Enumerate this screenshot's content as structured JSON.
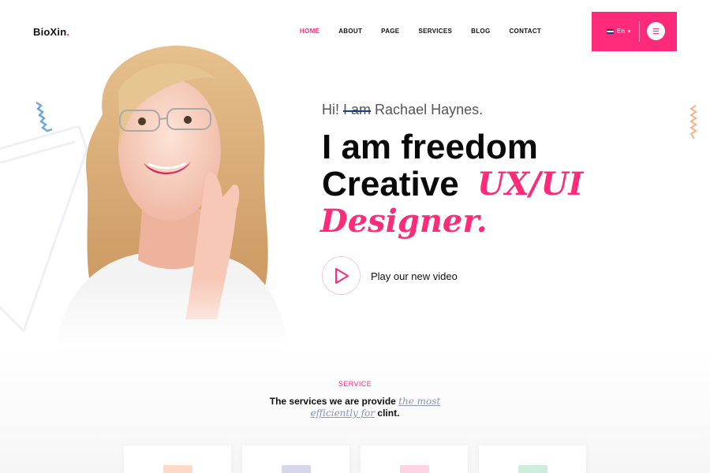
{
  "brand": {
    "name": "BioXin",
    "dot": ".",
    "accent": "#ff2a7a"
  },
  "nav": {
    "items": [
      "HOME",
      "ABOUT",
      "PAGE",
      "SERVICES",
      "BLOG",
      "CONTACT"
    ],
    "active_index": 0
  },
  "language": {
    "label": "En",
    "icon": "uk-flag-icon",
    "dropdown_icon": "chevron-down-icon"
  },
  "menu": {
    "icon": "hamburger-icon"
  },
  "hero": {
    "greeting_prefix": "Hi!",
    "greeting_struck": "I am",
    "greeting_name": "Rachael Haynes.",
    "line1": "I am freedom",
    "line2": "Creative",
    "line2_highlight": "UX/UI",
    "line3_highlight": "Designer.",
    "video_label": "Play our new video",
    "play_icon": "play-icon"
  },
  "services": {
    "tag": "SERVICE",
    "title_part1": "The services we are provide",
    "title_emphasis1": "the most",
    "title_emphasis2": "efficiently for",
    "title_part2": "clint.",
    "card_colors": [
      "#ffd9c8",
      "#d8d6ec",
      "#ffd3e3",
      "#cdeedd"
    ]
  }
}
